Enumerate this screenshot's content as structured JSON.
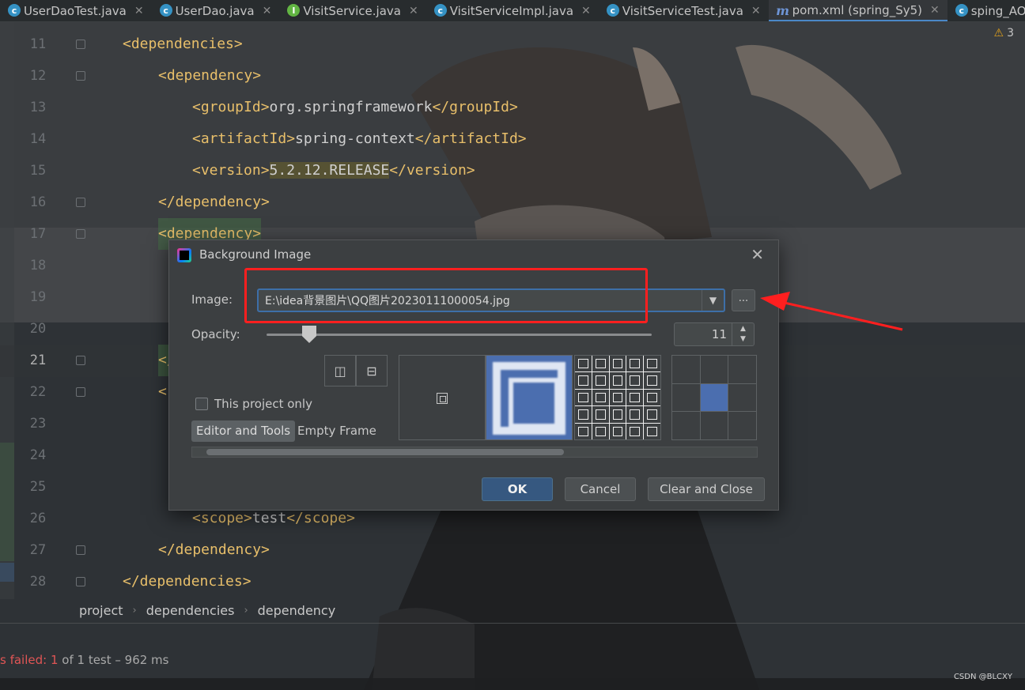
{
  "tabs": [
    {
      "label": "UserDaoTest.java",
      "icon": "c",
      "active": false
    },
    {
      "label": "UserDao.java",
      "icon": "c",
      "active": false
    },
    {
      "label": "VisitService.java",
      "icon": "i",
      "active": false
    },
    {
      "label": "VisitServiceImpl.java",
      "icon": "c",
      "active": false
    },
    {
      "label": "VisitServiceTest.java",
      "icon": "c",
      "active": false
    },
    {
      "label": "pom.xml (spring_Sy5)",
      "icon": "m",
      "active": true
    },
    {
      "label": "sping_AOP",
      "icon": "c",
      "active": false
    }
  ],
  "inspection": {
    "warnings": "3"
  },
  "editor": {
    "line_numbers": [
      "11",
      "12",
      "13",
      "14",
      "15",
      "16",
      "17",
      "18",
      "19",
      "20",
      "21",
      "22",
      "23",
      "24",
      "25",
      "26",
      "27",
      "28"
    ],
    "current_line": "21",
    "lines": {
      "l11": "<dependencies>",
      "l12": "<dependency>",
      "l13_open": "<groupId>",
      "l13_txt": "org.springframework",
      "l13_close": "</groupId>",
      "l14_open": "<artifactId>",
      "l14_txt": "spring-context",
      "l14_close": "</artifactId>",
      "l15_open": "<version>",
      "l15_txt": "5.2.12.RELEASE",
      "l15_close": "</version>",
      "l16": "</dependency>",
      "l17": "<dependency>",
      "l21": "</",
      "l22": "<",
      "l26_open": "<scope>",
      "l26_txt": "test",
      "l26_close": "</scope>",
      "l27": "</dependency>",
      "l28": "</dependencies>"
    }
  },
  "breadcrumb": [
    "project",
    "dependencies",
    "dependency"
  ],
  "run_status": {
    "prefix": "s failed: ",
    "failed_count": "1",
    "suffix": " of 1 test – 962 ms"
  },
  "watermark": "CSDN @BLCXY",
  "dialog": {
    "title": "Background Image",
    "image_label": "Image:",
    "image_path": "E:\\idea背景图片\\QQ图片20230111000054.jpg",
    "browse_label": "...",
    "opacity_label": "Opacity:",
    "opacity_value": "11",
    "opacity_fraction": 0.11,
    "this_project_only": "This project only",
    "this_project_checked": false,
    "segments": [
      "Editor and Tools",
      "Empty Frame"
    ],
    "selected_segment": "Editor and Tools",
    "fill_selected": "scale",
    "anchor_selected": "center",
    "buttons": {
      "ok": "OK",
      "cancel": "Cancel",
      "clear": "Clear and Close"
    }
  },
  "colors": {
    "annotation": "#ff1f1f",
    "accent": "#4b6eaf",
    "ok_button": "#365880"
  }
}
